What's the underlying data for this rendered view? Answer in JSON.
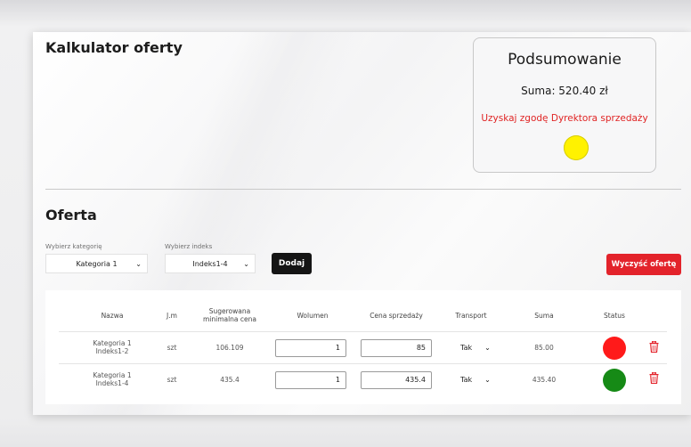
{
  "page": {
    "title": "Kalkulator oferty"
  },
  "summary": {
    "title": "Podsumowanie",
    "total": "Suma: 520.40 zł",
    "warning": "Uzyskaj zgodę Dyrektora sprzedaży",
    "light_color": "#fff200"
  },
  "offer": {
    "title": "Oferta",
    "category_label": "Wybierz kategorię",
    "category_value": "Kategoria 1",
    "index_label": "Wybierz indeks",
    "index_value": "Indeks1-4",
    "add_button": "Dodaj",
    "clear_button": "Wyczyść ofertę"
  },
  "table": {
    "headers": {
      "name": "Nazwa",
      "unit": "J.m",
      "min_price": "Sugerowana minimalna cena",
      "volume": "Wolumen",
      "sale_price": "Cena sprzedaży",
      "transport": "Transport",
      "sum": "Suma",
      "status": "Status"
    },
    "rows": [
      {
        "name_line1": "Kategoria 1",
        "name_line2": "Indeks1-2",
        "unit": "szt",
        "min_price": "106.109",
        "volume": "1",
        "sale_price": "85",
        "transport": "Tak",
        "sum": "85.00",
        "status_color": "#ff1a1a"
      },
      {
        "name_line1": "Kategoria 1",
        "name_line2": "Indeks1-4",
        "unit": "szt",
        "min_price": "435.4",
        "volume": "1",
        "sale_price": "435.4",
        "transport": "Tak",
        "sum": "435.40",
        "status_color": "#168a16"
      }
    ]
  },
  "colors": {
    "accent_red": "#e3232b",
    "dark_button": "#151515"
  }
}
